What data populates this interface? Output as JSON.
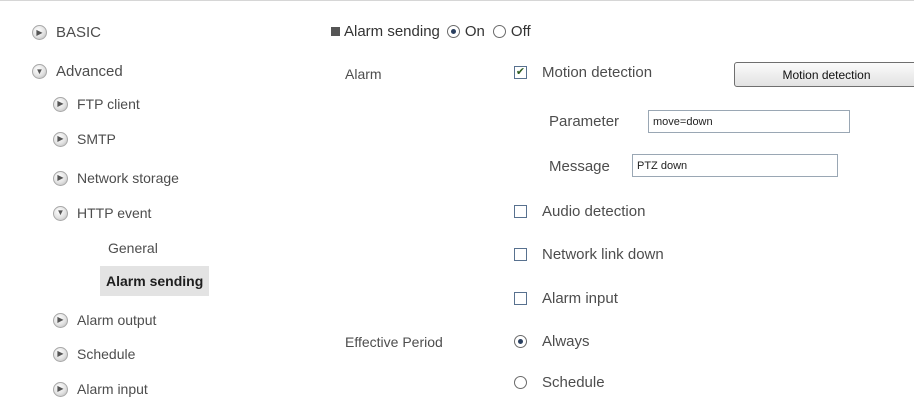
{
  "sidebar": {
    "basic": "BASIC",
    "advanced": "Advanced",
    "ftp_client": "FTP client",
    "smtp": "SMTP",
    "network_storage": "Network storage",
    "http_event": "HTTP event",
    "general": "General",
    "alarm_sending": "Alarm sending",
    "alarm_output": "Alarm output",
    "schedule": "Schedule",
    "alarm_input": "Alarm input"
  },
  "form": {
    "title": "Alarm sending",
    "on_label": "On",
    "off_label": "Off",
    "alarm_label": "Alarm",
    "motion_detection": "Motion detection",
    "motion_detection_button": "Motion detection",
    "parameter_label": "Parameter",
    "parameter_value": "move=down",
    "message_label": "Message",
    "message_value": "PTZ down",
    "audio_detection": "Audio detection",
    "network_link_down": "Network link down",
    "alarm_input": "Alarm input",
    "effective_period_label": "Effective Period",
    "always": "Always",
    "schedule": "Schedule"
  }
}
